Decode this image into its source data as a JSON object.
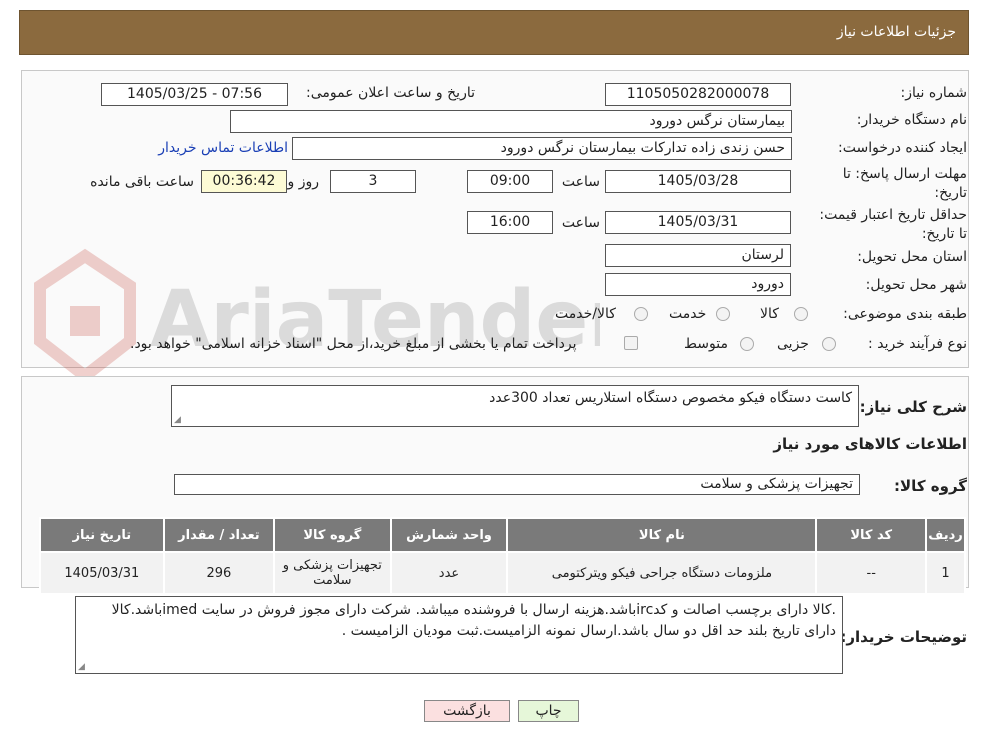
{
  "header": {
    "title": "جزئیات اطلاعات نیاز"
  },
  "watermark": {
    "text": "AriaTender.neT"
  },
  "fields": {
    "need_number_label": "شماره نیاز:",
    "need_number_value": "1105050282000078",
    "announce_label": "تاریخ و ساعت اعلان عمومی:",
    "announce_value": "1405/03/25 - 07:56",
    "buyer_org_label": "نام دستگاه خریدار:",
    "buyer_org_value": "بیمارستان نرگس دورود",
    "creator_label": "ایجاد کننده درخواست:",
    "creator_value": "حسن  زندی زاده  تدارکات بیمارستان نرگس دورود",
    "contact_link": "اطلاعات تماس خریدار",
    "deadline_label": "مهلت ارسال پاسخ: تا تاریخ:",
    "deadline_date": "1405/03/28",
    "deadline_time_label": "ساعت",
    "deadline_time": "09:00",
    "days_value": "3",
    "days_label": "روز و",
    "remaining_value": "00:36:42",
    "remaining_label": "ساعت باقی مانده",
    "validity_label": "حداقل تاریخ اعتبار قیمت: تا تاریخ:",
    "validity_date": "1405/03/31",
    "validity_time_label": "ساعت",
    "validity_time": "16:00",
    "province_label": "استان محل تحویل:",
    "province_value": "لرستان",
    "city_label": "شهر محل تحویل:",
    "city_value": "دورود",
    "category_label": "طبقه بندی موضوعی:",
    "category_options": [
      "کالا",
      "خدمت",
      "کالا/خدمت"
    ],
    "process_label": "نوع فرآیند خرید :",
    "process_options": [
      "جزیی",
      "متوسط"
    ],
    "process_note": "پرداخت تمام یا بخشی از مبلغ خرید،از محل \"اسناد خزانه اسلامی\" خواهد بود."
  },
  "description": {
    "label": "شرح کلی نیاز:",
    "value": "کاست دستگاه  فیکو  مخصوص دستگاه استلاریس تعداد 300عدد"
  },
  "goods_section": {
    "title": "اطلاعات کالاهای مورد نیاز",
    "group_label": "گروه کالا:",
    "group_value": "تجهیزات پزشکی و سلامت"
  },
  "table": {
    "headers": [
      "ردیف",
      "کد کالا",
      "نام کالا",
      "واحد شمارش",
      "گروه کالا",
      "تعداد / مقدار",
      "تاریخ نیاز"
    ],
    "rows": [
      [
        "1",
        "--",
        "ملزومات دستگاه جراحی فیکو ویترکتومی",
        "عدد",
        "تجهیزات پزشکی و سلامت",
        "296",
        "1405/03/31"
      ]
    ]
  },
  "buyer_notes": {
    "label": "توضیحات خریدار:",
    "line1": ".کالا دارای برچسب اصالت و کدircباشد.هزینه ارسال با فروشنده میباشد. شرکت دارای مجوز فروش در سایت imedباشد.کالا",
    "line2": "دارای تاریخ بلند حد اقل دو سال باشد.ارسال نمونه الزامیست.ثبت مودیان الزامیست ."
  },
  "buttons": {
    "print": "چاپ",
    "back": "بازگشت"
  },
  "colors": {
    "header_bg": "#8b6a3e",
    "table_header_bg": "#7a7a7a",
    "print_bg": "#e6f7d9",
    "back_bg": "#fbe0e0",
    "link": "#1a3fb5"
  }
}
